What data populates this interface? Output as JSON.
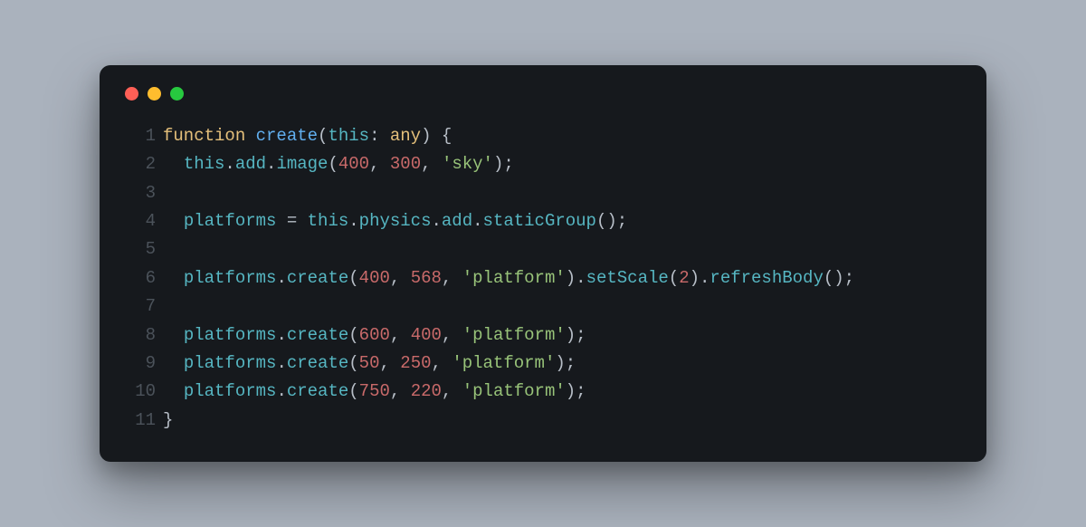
{
  "window": {
    "traffic_lights": [
      "close",
      "minimize",
      "zoom"
    ]
  },
  "code": {
    "language": "typescript",
    "lines": [
      {
        "n": "1",
        "tokens": [
          {
            "t": "function ",
            "c": "tk-keyword"
          },
          {
            "t": "create",
            "c": "tk-funcname"
          },
          {
            "t": "(",
            "c": "tk-op"
          },
          {
            "t": "this",
            "c": "tk-this"
          },
          {
            "t": ": ",
            "c": "tk-op"
          },
          {
            "t": "any",
            "c": "tk-type"
          },
          {
            "t": ") {",
            "c": "tk-op"
          }
        ]
      },
      {
        "n": "2",
        "tokens": [
          {
            "t": "  ",
            "c": "tk-default"
          },
          {
            "t": "this",
            "c": "tk-this"
          },
          {
            "t": ".",
            "c": "tk-op"
          },
          {
            "t": "add",
            "c": "tk-ident"
          },
          {
            "t": ".",
            "c": "tk-op"
          },
          {
            "t": "image",
            "c": "tk-ident"
          },
          {
            "t": "(",
            "c": "tk-op"
          },
          {
            "t": "400",
            "c": "tk-num"
          },
          {
            "t": ", ",
            "c": "tk-op"
          },
          {
            "t": "300",
            "c": "tk-num"
          },
          {
            "t": ", ",
            "c": "tk-op"
          },
          {
            "t": "'sky'",
            "c": "tk-str"
          },
          {
            "t": ");",
            "c": "tk-op"
          }
        ]
      },
      {
        "n": "3",
        "tokens": [
          {
            "t": "",
            "c": "tk-default"
          }
        ]
      },
      {
        "n": "4",
        "tokens": [
          {
            "t": "  ",
            "c": "tk-default"
          },
          {
            "t": "platforms ",
            "c": "tk-ident"
          },
          {
            "t": "= ",
            "c": "tk-op"
          },
          {
            "t": "this",
            "c": "tk-this"
          },
          {
            "t": ".",
            "c": "tk-op"
          },
          {
            "t": "physics",
            "c": "tk-ident"
          },
          {
            "t": ".",
            "c": "tk-op"
          },
          {
            "t": "add",
            "c": "tk-ident"
          },
          {
            "t": ".",
            "c": "tk-op"
          },
          {
            "t": "staticGroup",
            "c": "tk-ident"
          },
          {
            "t": "();",
            "c": "tk-op"
          }
        ]
      },
      {
        "n": "5",
        "tokens": [
          {
            "t": "",
            "c": "tk-default"
          }
        ]
      },
      {
        "n": "6",
        "tokens": [
          {
            "t": "  ",
            "c": "tk-default"
          },
          {
            "t": "platforms",
            "c": "tk-ident"
          },
          {
            "t": ".",
            "c": "tk-op"
          },
          {
            "t": "create",
            "c": "tk-ident"
          },
          {
            "t": "(",
            "c": "tk-op"
          },
          {
            "t": "400",
            "c": "tk-num"
          },
          {
            "t": ", ",
            "c": "tk-op"
          },
          {
            "t": "568",
            "c": "tk-num"
          },
          {
            "t": ", ",
            "c": "tk-op"
          },
          {
            "t": "'platform'",
            "c": "tk-str"
          },
          {
            "t": ").",
            "c": "tk-op"
          },
          {
            "t": "setScale",
            "c": "tk-ident"
          },
          {
            "t": "(",
            "c": "tk-op"
          },
          {
            "t": "2",
            "c": "tk-num"
          },
          {
            "t": ").",
            "c": "tk-op"
          },
          {
            "t": "refreshBody",
            "c": "tk-ident"
          },
          {
            "t": "();",
            "c": "tk-op"
          }
        ]
      },
      {
        "n": "7",
        "tokens": [
          {
            "t": "",
            "c": "tk-default"
          }
        ]
      },
      {
        "n": "8",
        "tokens": [
          {
            "t": "  ",
            "c": "tk-default"
          },
          {
            "t": "platforms",
            "c": "tk-ident"
          },
          {
            "t": ".",
            "c": "tk-op"
          },
          {
            "t": "create",
            "c": "tk-ident"
          },
          {
            "t": "(",
            "c": "tk-op"
          },
          {
            "t": "600",
            "c": "tk-num"
          },
          {
            "t": ", ",
            "c": "tk-op"
          },
          {
            "t": "400",
            "c": "tk-num"
          },
          {
            "t": ", ",
            "c": "tk-op"
          },
          {
            "t": "'platform'",
            "c": "tk-str"
          },
          {
            "t": ");",
            "c": "tk-op"
          }
        ]
      },
      {
        "n": "9",
        "tokens": [
          {
            "t": "  ",
            "c": "tk-default"
          },
          {
            "t": "platforms",
            "c": "tk-ident"
          },
          {
            "t": ".",
            "c": "tk-op"
          },
          {
            "t": "create",
            "c": "tk-ident"
          },
          {
            "t": "(",
            "c": "tk-op"
          },
          {
            "t": "50",
            "c": "tk-num"
          },
          {
            "t": ", ",
            "c": "tk-op"
          },
          {
            "t": "250",
            "c": "tk-num"
          },
          {
            "t": ", ",
            "c": "tk-op"
          },
          {
            "t": "'platform'",
            "c": "tk-str"
          },
          {
            "t": ");",
            "c": "tk-op"
          }
        ]
      },
      {
        "n": "10",
        "tokens": [
          {
            "t": "  ",
            "c": "tk-default"
          },
          {
            "t": "platforms",
            "c": "tk-ident"
          },
          {
            "t": ".",
            "c": "tk-op"
          },
          {
            "t": "create",
            "c": "tk-ident"
          },
          {
            "t": "(",
            "c": "tk-op"
          },
          {
            "t": "750",
            "c": "tk-num"
          },
          {
            "t": ", ",
            "c": "tk-op"
          },
          {
            "t": "220",
            "c": "tk-num"
          },
          {
            "t": ", ",
            "c": "tk-op"
          },
          {
            "t": "'platform'",
            "c": "tk-str"
          },
          {
            "t": ");",
            "c": "tk-op"
          }
        ]
      },
      {
        "n": "11",
        "tokens": [
          {
            "t": "}",
            "c": "tk-op"
          }
        ]
      }
    ]
  }
}
